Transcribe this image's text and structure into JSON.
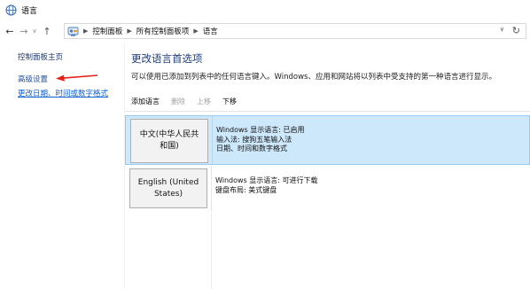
{
  "window": {
    "title": "语言",
    "icon": "language-globe-icon"
  },
  "nav": {
    "back_icon": "back-arrow-icon",
    "forward_icon": "forward-arrow-icon",
    "recent_icon": "chevron-down-icon",
    "up_icon": "up-arrow-icon",
    "breadcrumb": [
      "控制面板",
      "所有控制面板项",
      "语言"
    ],
    "address_dropdown_icon": "chevron-down-icon",
    "refresh_icon": "refresh-icon"
  },
  "sidebar": {
    "home": "控制面板主页",
    "advanced": "高级设置",
    "date_time": "更改日期、时间或数字格式"
  },
  "annotation": {
    "arrow_color": "#e8201a"
  },
  "main": {
    "heading": "更改语言首选项",
    "description": "可以使用已添加到列表中的任何语言键入。Windows、应用和网站将以列表中受支持的第一种语言进行显示。",
    "toolbar": {
      "add": "添加语言",
      "remove": "删除",
      "up": "上移",
      "down": "下移"
    },
    "languages": [
      {
        "name": "中文(中华人民共和国)",
        "name_line1": "中文(中华人民共",
        "name_line2": "和国)",
        "selected": true,
        "details": [
          "Windows 显示语言: 已启用",
          "输入法: 搜狗五笔输入法",
          "日期、时间和数字格式"
        ]
      },
      {
        "name": "English (United States)",
        "name_line1": "English (United",
        "name_line2": "States)",
        "selected": false,
        "details": [
          "Windows 显示语言: 可进行下载",
          "键盘布局: 美式键盘"
        ]
      }
    ]
  },
  "colors": {
    "heading": "#1f3d7a",
    "link": "#0a5fd1",
    "selection": "#cde8fb",
    "selection_border": "#99c9ef"
  }
}
